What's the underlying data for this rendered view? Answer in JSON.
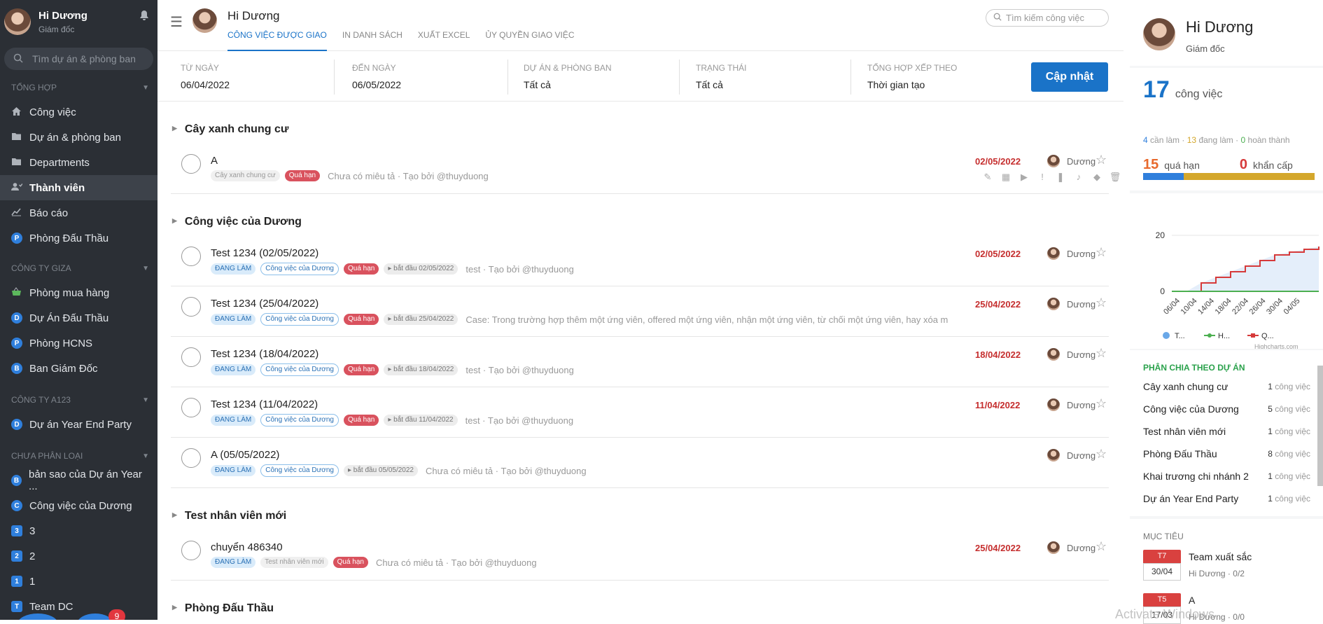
{
  "sidebar": {
    "user": {
      "name": "Hi Dương",
      "role": "Giám đốc"
    },
    "search_placeholder": "Tìm dự án & phòng ban",
    "sections": [
      {
        "title": "TỔNG HỢP",
        "items": [
          {
            "label": "Công việc",
            "icon": "home-icon"
          },
          {
            "label": "Dự án & phòng ban",
            "icon": "folder-icon"
          },
          {
            "label": "Departments",
            "icon": "folder-icon"
          },
          {
            "label": "Thành viên",
            "icon": "users-icon"
          },
          {
            "label": "Báo cáo",
            "icon": "chart-icon"
          },
          {
            "label": "Phòng Đấu Thầu",
            "badge": "P"
          }
        ]
      },
      {
        "title": "CÔNG TY GIZA",
        "items": [
          {
            "label": "Phòng mua hàng",
            "icon": "basket-icon"
          },
          {
            "label": "Dự Án Đấu Thầu",
            "badge": "D"
          },
          {
            "label": "Phòng HCNS",
            "badge": "P"
          },
          {
            "label": "Ban Giám Đốc",
            "badge": "B"
          }
        ]
      },
      {
        "title": "CÔNG TY A123",
        "items": [
          {
            "label": "Dự án Year End Party",
            "badge": "D"
          }
        ]
      },
      {
        "title": "CHƯA PHÂN LOẠI",
        "items": [
          {
            "label": "bản sao của Dự án Year ...",
            "badge": "B"
          },
          {
            "label": "Công việc của Dương",
            "badge": "C"
          },
          {
            "label": "3",
            "badge": "3"
          },
          {
            "label": "2",
            "badge": "2"
          },
          {
            "label": "1",
            "badge": "1"
          },
          {
            "label": "Team DC",
            "badge": "T"
          }
        ]
      }
    ],
    "float_badge": "9"
  },
  "header": {
    "title": "Hi Dương",
    "tabs": [
      "CÔNG VIỆC ĐƯỢC GIAO",
      "IN DANH SÁCH",
      "XUẤT EXCEL",
      "ỦY QUYỀN GIAO VIỆC"
    ],
    "search_placeholder": "Tìm kiếm công việc"
  },
  "filters": {
    "from": {
      "label": "TỪ NGÀY",
      "value": "06/04/2022"
    },
    "to": {
      "label": "ĐẾN NGÀY",
      "value": "06/05/2022"
    },
    "project": {
      "label": "DỰ ÁN & PHÒNG BAN",
      "value": "Tất cả"
    },
    "status": {
      "label": "TRẠNG THÁI",
      "value": "Tất cả"
    },
    "sort": {
      "label": "TỔNG HỢP XẾP THEO",
      "value": "Thời gian tạo"
    },
    "update_label": "Cập nhật"
  },
  "groups": [
    {
      "title": "Cây xanh chung cư",
      "tasks": [
        {
          "title": "A",
          "pills": [
            {
              "t": "Cây xanh chung cư",
              "k": "gr"
            },
            {
              "t": "Quá hạn",
              "k": "od"
            }
          ],
          "desc": "Chưa có miêu tả · Tạo bởi @thuyduong",
          "due": "02/05/2022",
          "user": "Dương",
          "actions": true
        }
      ]
    },
    {
      "title": "Công việc của Dương",
      "tasks": [
        {
          "title": "Test 1234 (02/05/2022)",
          "pills": [
            {
              "t": "ĐANG LÀM",
              "k": "st"
            },
            {
              "t": "Công việc của Dương",
              "k": "pr"
            },
            {
              "t": "Quá hạn",
              "k": "od"
            },
            {
              "t": "▸ bắt đầu 02/05/2022",
              "k": "bg"
            }
          ],
          "desc": "test · Tạo bởi @thuyduong",
          "due": "02/05/2022",
          "user": "Dương"
        },
        {
          "title": "Test 1234 (25/04/2022)",
          "pills": [
            {
              "t": "ĐANG LÀM",
              "k": "st"
            },
            {
              "t": "Công việc của Dương",
              "k": "pr"
            },
            {
              "t": "Quá hạn",
              "k": "od"
            },
            {
              "t": "▸ bắt đầu 25/04/2022",
              "k": "bg"
            }
          ],
          "desc": "Case:  Trong trường hợp thêm một ứng viên, offered một ứng viên, nhận một ứng viên, từ chối một ứng viên, hay xóa một",
          "due": "25/04/2022",
          "user": "Dương"
        },
        {
          "title": "Test 1234 (18/04/2022)",
          "pills": [
            {
              "t": "ĐANG LÀM",
              "k": "st"
            },
            {
              "t": "Công việc của Dương",
              "k": "pr"
            },
            {
              "t": "Quá hạn",
              "k": "od"
            },
            {
              "t": "▸ bắt đầu 18/04/2022",
              "k": "bg"
            }
          ],
          "desc": "test · Tạo bởi @thuyduong",
          "due": "18/04/2022",
          "user": "Dương"
        },
        {
          "title": "Test 1234 (11/04/2022)",
          "pills": [
            {
              "t": "ĐANG LÀM",
              "k": "st"
            },
            {
              "t": "Công việc của Dương",
              "k": "pr"
            },
            {
              "t": "Quá hạn",
              "k": "od"
            },
            {
              "t": "▸ bắt đầu 11/04/2022",
              "k": "bg"
            }
          ],
          "desc": "test · Tạo bởi @thuyduong",
          "due": "11/04/2022",
          "user": "Dương"
        },
        {
          "title": "A (05/05/2022)",
          "pills": [
            {
              "t": "ĐANG LÀM",
              "k": "st"
            },
            {
              "t": "Công việc của Dương",
              "k": "pr"
            },
            {
              "t": "▸ bắt đầu 05/05/2022",
              "k": "bg"
            }
          ],
          "desc": "Chưa có miêu tả · Tạo bởi @thuyduong",
          "due": "",
          "user": "Dương"
        }
      ]
    },
    {
      "title": "Test nhân viên mới",
      "tasks": [
        {
          "title": "chuyển 486340",
          "pills": [
            {
              "t": "ĐANG LÀM",
              "k": "st"
            },
            {
              "t": "Test nhân viên mới",
              "k": "gr"
            },
            {
              "t": "Quá hạn",
              "k": "od"
            }
          ],
          "desc": "Chưa có miêu tả · Tạo bởi @thuyduong",
          "due": "25/04/2022",
          "user": "Dương"
        }
      ]
    },
    {
      "title": "Phòng Đấu Thầu",
      "tasks": []
    }
  ],
  "right": {
    "name": "Hi Dương",
    "role": "Giám đốc",
    "total": "17",
    "total_label": "công việc",
    "todo": "4",
    "todo_label": "cần làm",
    "doing": "13",
    "doing_label": "đang làm",
    "done": "0",
    "done_label": "hoàn thành",
    "overdue": "15",
    "overdue_label": "quá hạn",
    "urgent": "0",
    "urgent_label": "khẩn cấp",
    "colors": {
      "todo": "#2f7fdc",
      "doing": "#d4a72c",
      "done": "#4caf50",
      "overdue": "#e8692c",
      "urgent": "#d63a3a"
    },
    "chart_credit": "Highcharts.com",
    "projects_title": "PHÂN CHIA THEO DỰ ÁN",
    "projects": [
      {
        "name": "Cây xanh chung cư",
        "count": "1",
        "unit": "công việc"
      },
      {
        "name": "Công việc của Dương",
        "count": "5",
        "unit": "công việc"
      },
      {
        "name": "Test nhân viên mới",
        "count": "1",
        "unit": "công việc"
      },
      {
        "name": "Phòng Đấu Thầu",
        "count": "8",
        "unit": "công việc"
      },
      {
        "name": "Khai trương chi nhánh 2",
        "count": "1",
        "unit": "công việc"
      },
      {
        "name": "Dự án Year End Party",
        "count": "1",
        "unit": "công việc"
      }
    ],
    "goals_title": "MỤC TIÊU",
    "goals": [
      {
        "day": "T7",
        "date": "30/04",
        "name": "Team xuất sắc",
        "owner": "Hi Dương",
        "progress": "0/2"
      },
      {
        "day": "T5",
        "date": "17/03",
        "name": "A",
        "owner": "Hi Dương",
        "progress": "0/0"
      }
    ]
  },
  "chart_data": {
    "type": "line",
    "x": [
      "06/04",
      "10/04",
      "14/04",
      "18/04",
      "22/04",
      "26/04",
      "30/04",
      "04/05"
    ],
    "ylim": [
      0,
      20
    ],
    "yticks": [
      "0",
      "20"
    ],
    "legend": [
      "T...",
      "H...",
      "Q..."
    ],
    "series": [
      {
        "values": [
          0,
          0,
          3,
          5,
          7,
          9,
          11,
          13,
          14,
          15,
          16
        ],
        "color": "#d63a3a"
      },
      {
        "values": [
          0,
          0,
          0,
          0,
          0,
          0,
          0,
          0,
          0,
          0,
          0
        ],
        "color": "#4caf50"
      }
    ]
  },
  "watermark": "Activate Windows"
}
